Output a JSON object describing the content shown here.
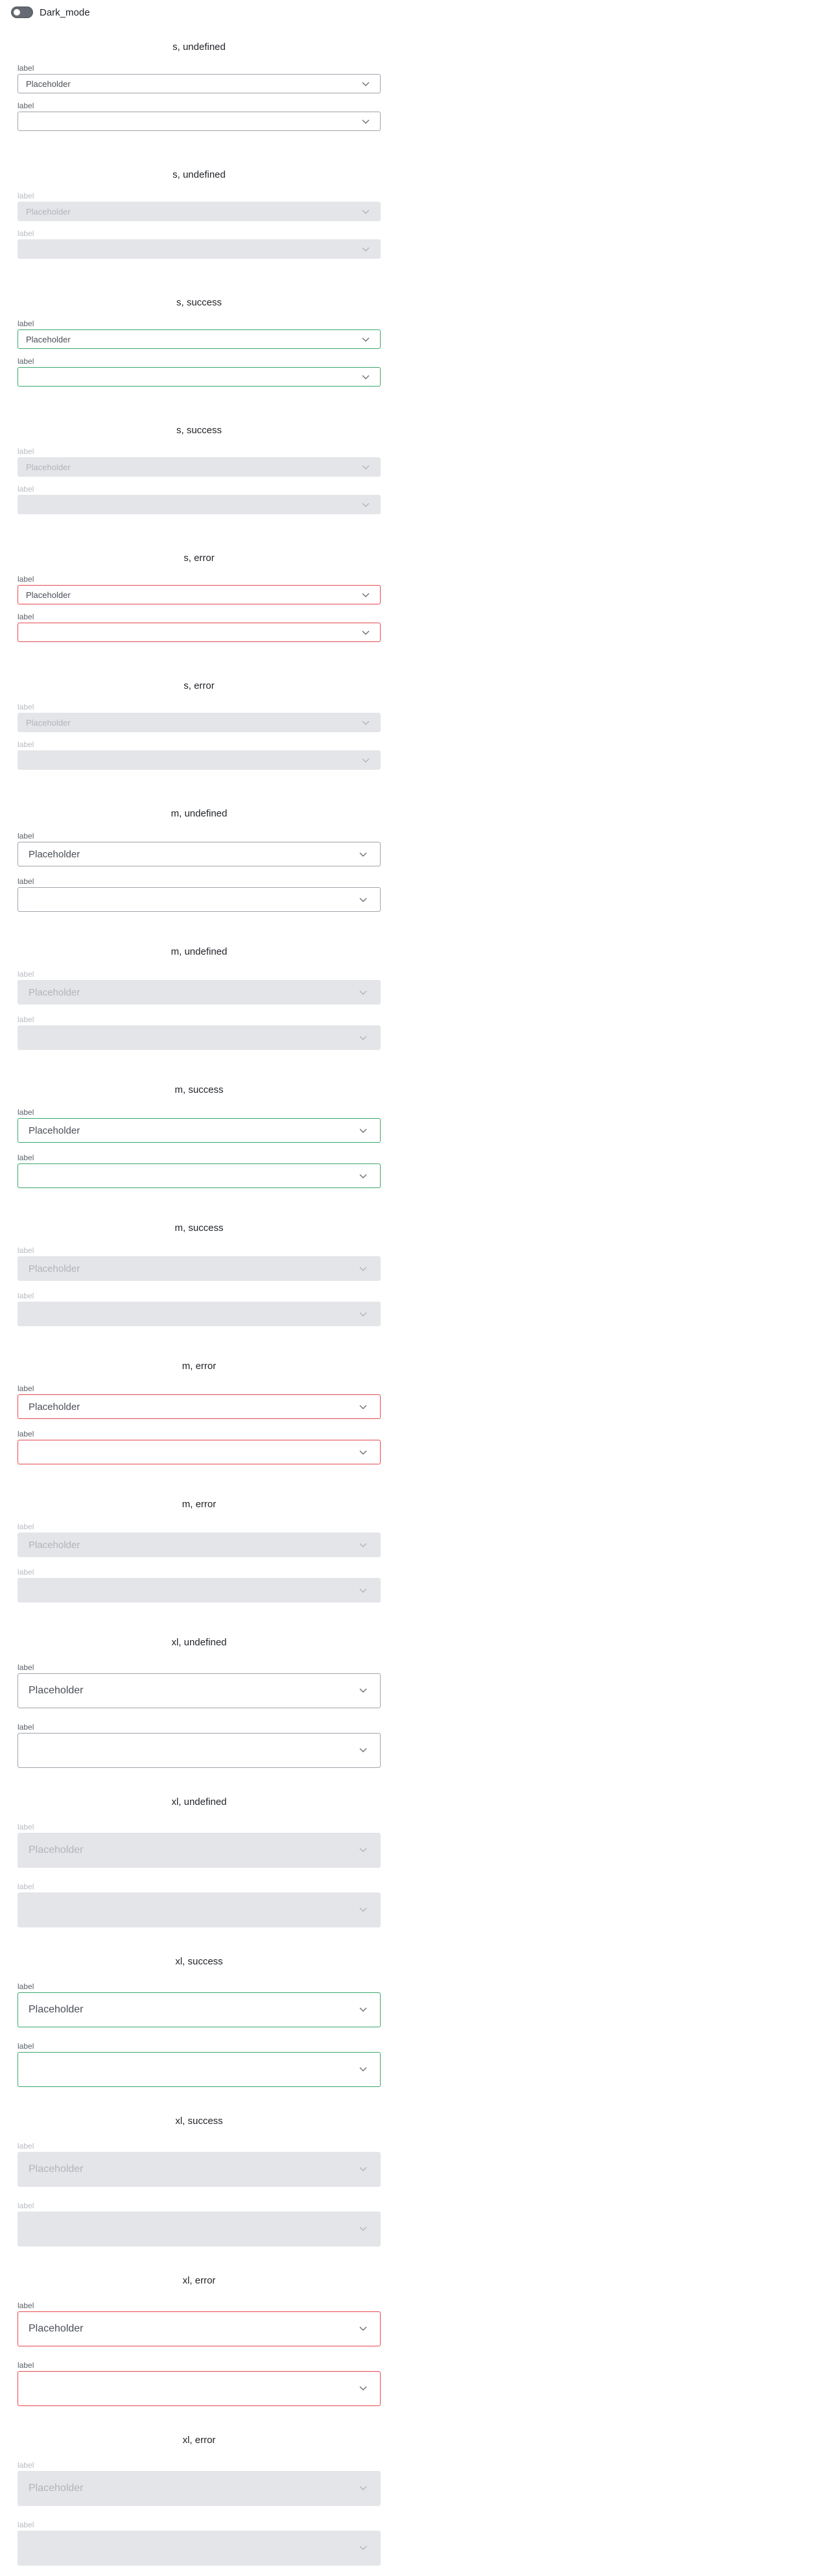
{
  "toggle": {
    "label": "Dark_mode",
    "on": false
  },
  "groups": [
    {
      "title": "s, undefined",
      "size": "s",
      "status": "undefined",
      "disabled": false,
      "fields": [
        {
          "label": "label",
          "value": "Placeholder"
        },
        {
          "label": "label",
          "value": ""
        }
      ]
    },
    {
      "title": "s, undefined",
      "size": "s",
      "status": "undefined",
      "disabled": true,
      "fields": [
        {
          "label": "label",
          "value": "Placeholder"
        },
        {
          "label": "label",
          "value": ""
        }
      ]
    },
    {
      "title": "s, success",
      "size": "s",
      "status": "success",
      "disabled": false,
      "fields": [
        {
          "label": "label",
          "value": "Placeholder"
        },
        {
          "label": "label",
          "value": ""
        }
      ]
    },
    {
      "title": "s, success",
      "size": "s",
      "status": "success",
      "disabled": true,
      "fields": [
        {
          "label": "label",
          "value": "Placeholder"
        },
        {
          "label": "label",
          "value": ""
        }
      ]
    },
    {
      "title": "s, error",
      "size": "s",
      "status": "error",
      "disabled": false,
      "fields": [
        {
          "label": "label",
          "value": "Placeholder"
        },
        {
          "label": "label",
          "value": ""
        }
      ]
    },
    {
      "title": "s, error",
      "size": "s",
      "status": "error",
      "disabled": true,
      "fields": [
        {
          "label": "label",
          "value": "Placeholder"
        },
        {
          "label": "label",
          "value": ""
        }
      ]
    },
    {
      "title": "m, undefined",
      "size": "m",
      "status": "undefined",
      "disabled": false,
      "fields": [
        {
          "label": "label",
          "value": "Placeholder"
        },
        {
          "label": "label",
          "value": ""
        }
      ]
    },
    {
      "title": "m, undefined",
      "size": "m",
      "status": "undefined",
      "disabled": true,
      "fields": [
        {
          "label": "label",
          "value": "Placeholder"
        },
        {
          "label": "label",
          "value": ""
        }
      ]
    },
    {
      "title": "m, success",
      "size": "m",
      "status": "success",
      "disabled": false,
      "fields": [
        {
          "label": "label",
          "value": "Placeholder"
        },
        {
          "label": "label",
          "value": ""
        }
      ]
    },
    {
      "title": "m, success",
      "size": "m",
      "status": "success",
      "disabled": true,
      "fields": [
        {
          "label": "label",
          "value": "Placeholder"
        },
        {
          "label": "label",
          "value": ""
        }
      ]
    },
    {
      "title": "m, error",
      "size": "m",
      "status": "error",
      "disabled": false,
      "fields": [
        {
          "label": "label",
          "value": "Placeholder"
        },
        {
          "label": "label",
          "value": ""
        }
      ]
    },
    {
      "title": "m, error",
      "size": "m",
      "status": "error",
      "disabled": true,
      "fields": [
        {
          "label": "label",
          "value": "Placeholder"
        },
        {
          "label": "label",
          "value": ""
        }
      ]
    },
    {
      "title": "xl, undefined",
      "size": "xl",
      "status": "undefined",
      "disabled": false,
      "fields": [
        {
          "label": "label",
          "value": "Placeholder"
        },
        {
          "label": "label",
          "value": ""
        }
      ]
    },
    {
      "title": "xl, undefined",
      "size": "xl",
      "status": "undefined",
      "disabled": true,
      "fields": [
        {
          "label": "label",
          "value": "Placeholder"
        },
        {
          "label": "label",
          "value": ""
        }
      ]
    },
    {
      "title": "xl, success",
      "size": "xl",
      "status": "success",
      "disabled": false,
      "fields": [
        {
          "label": "label",
          "value": "Placeholder"
        },
        {
          "label": "label",
          "value": ""
        }
      ]
    },
    {
      "title": "xl, success",
      "size": "xl",
      "status": "success",
      "disabled": true,
      "fields": [
        {
          "label": "label",
          "value": "Placeholder"
        },
        {
          "label": "label",
          "value": ""
        }
      ]
    },
    {
      "title": "xl, error",
      "size": "xl",
      "status": "error",
      "disabled": false,
      "fields": [
        {
          "label": "label",
          "value": "Placeholder"
        },
        {
          "label": "label",
          "value": ""
        }
      ]
    },
    {
      "title": "xl, error",
      "size": "xl",
      "status": "error",
      "disabled": true,
      "fields": [
        {
          "label": "label",
          "value": "Placeholder"
        },
        {
          "label": "label",
          "value": ""
        }
      ]
    }
  ],
  "icons": {
    "toggle": "toggle-switch-icon",
    "chevron": "chevron-down-icon"
  },
  "colors": {
    "success": "#3aa66c",
    "error": "#e5484d",
    "default_border": "#9ea3aa",
    "disabled_fill": "#e4e5e8"
  }
}
